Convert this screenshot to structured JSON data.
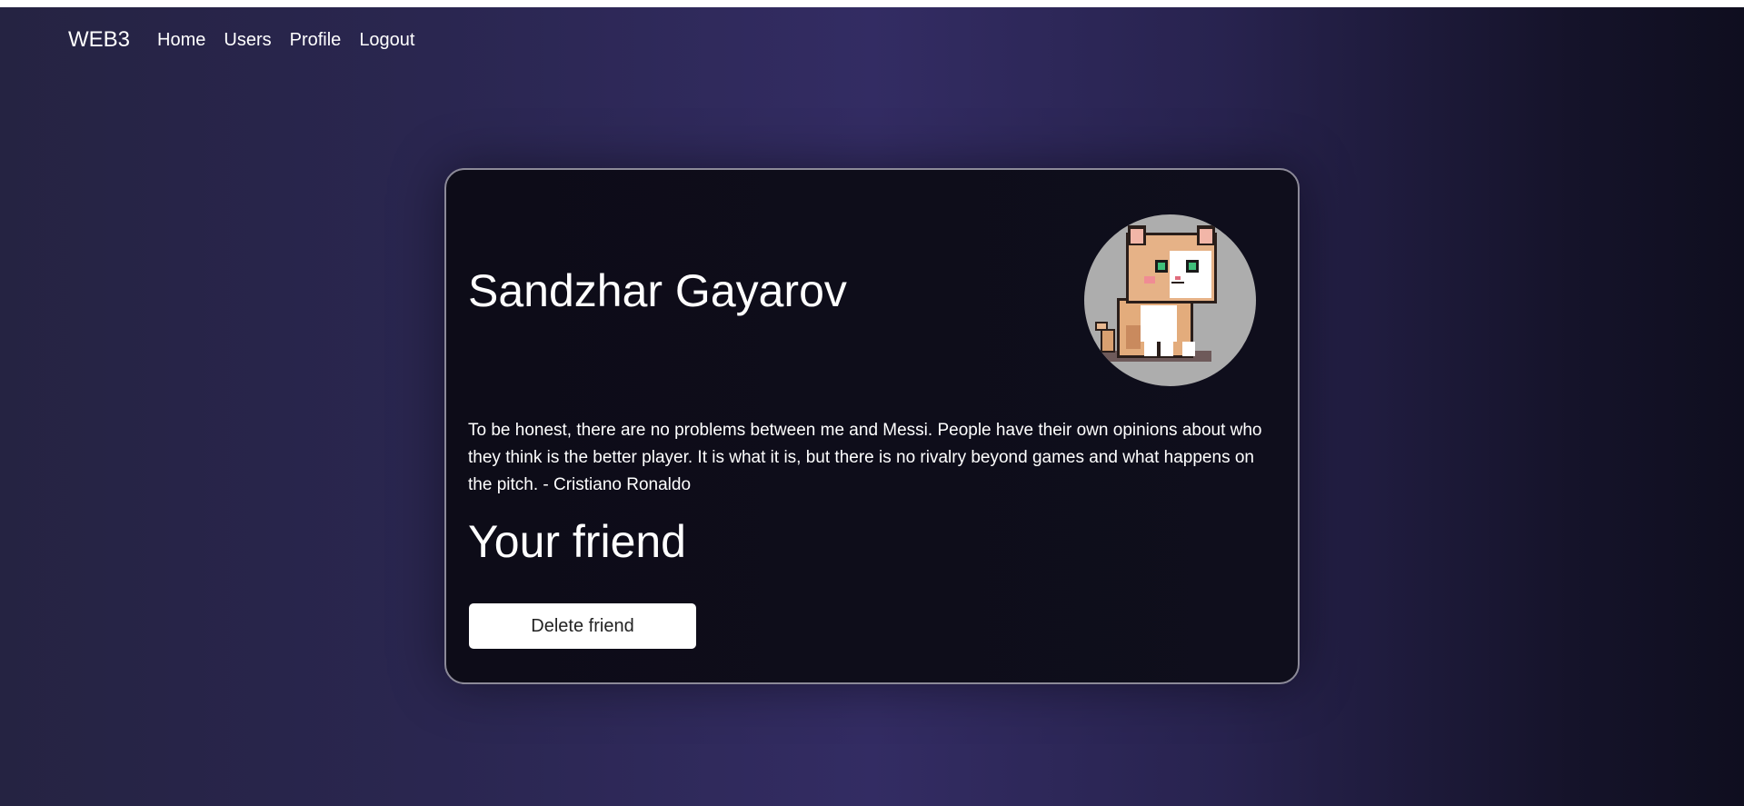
{
  "nav": {
    "brand": "WEB3",
    "links": [
      "Home",
      "Users",
      "Profile",
      "Logout"
    ]
  },
  "profile": {
    "name": "Sandzhar Gayarov",
    "bio": "To be honest, there are no problems between me and Messi. People have their own opinions about who they think is the better player. It is what it is, but there is no rivalry beyond games and what happens on the pitch. - Cristiano Ronaldo",
    "friend_status": "Your friend",
    "delete_button_label": "Delete friend",
    "avatar_icon": "pixel-cat-icon"
  },
  "colors": {
    "card_background": "#0e0d1b",
    "avatar_background": "#adadad",
    "button_background": "#ffffff"
  }
}
